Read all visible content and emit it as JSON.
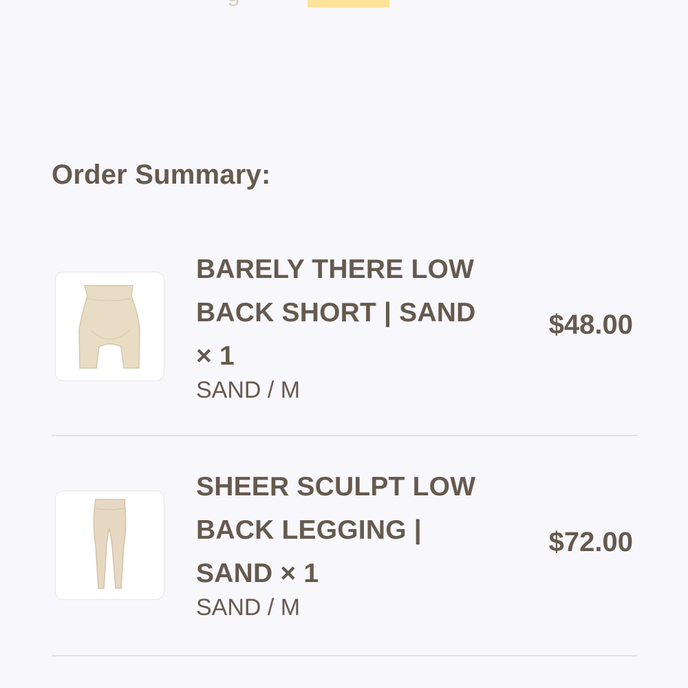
{
  "order_summary": {
    "title": "Order Summary:",
    "items": [
      {
        "name": "BARELY THERE LOW BACK SHORT | SAND × 1",
        "variant": "SAND / M",
        "price": "$48.00",
        "thumbnail_icon": "shorts-product-icon",
        "thumbnail_color": "#e9dcc4"
      },
      {
        "name": "SHEER SCULPT LOW BACK LEGGING | SAND × 1",
        "variant": "SAND / M",
        "price": "$72.00",
        "thumbnail_icon": "legging-product-icon",
        "thumbnail_color": "#e6d8c2"
      }
    ]
  },
  "colors": {
    "text": "#655a4e",
    "background": "#f8f7fc",
    "highlight": "#fde49a"
  }
}
